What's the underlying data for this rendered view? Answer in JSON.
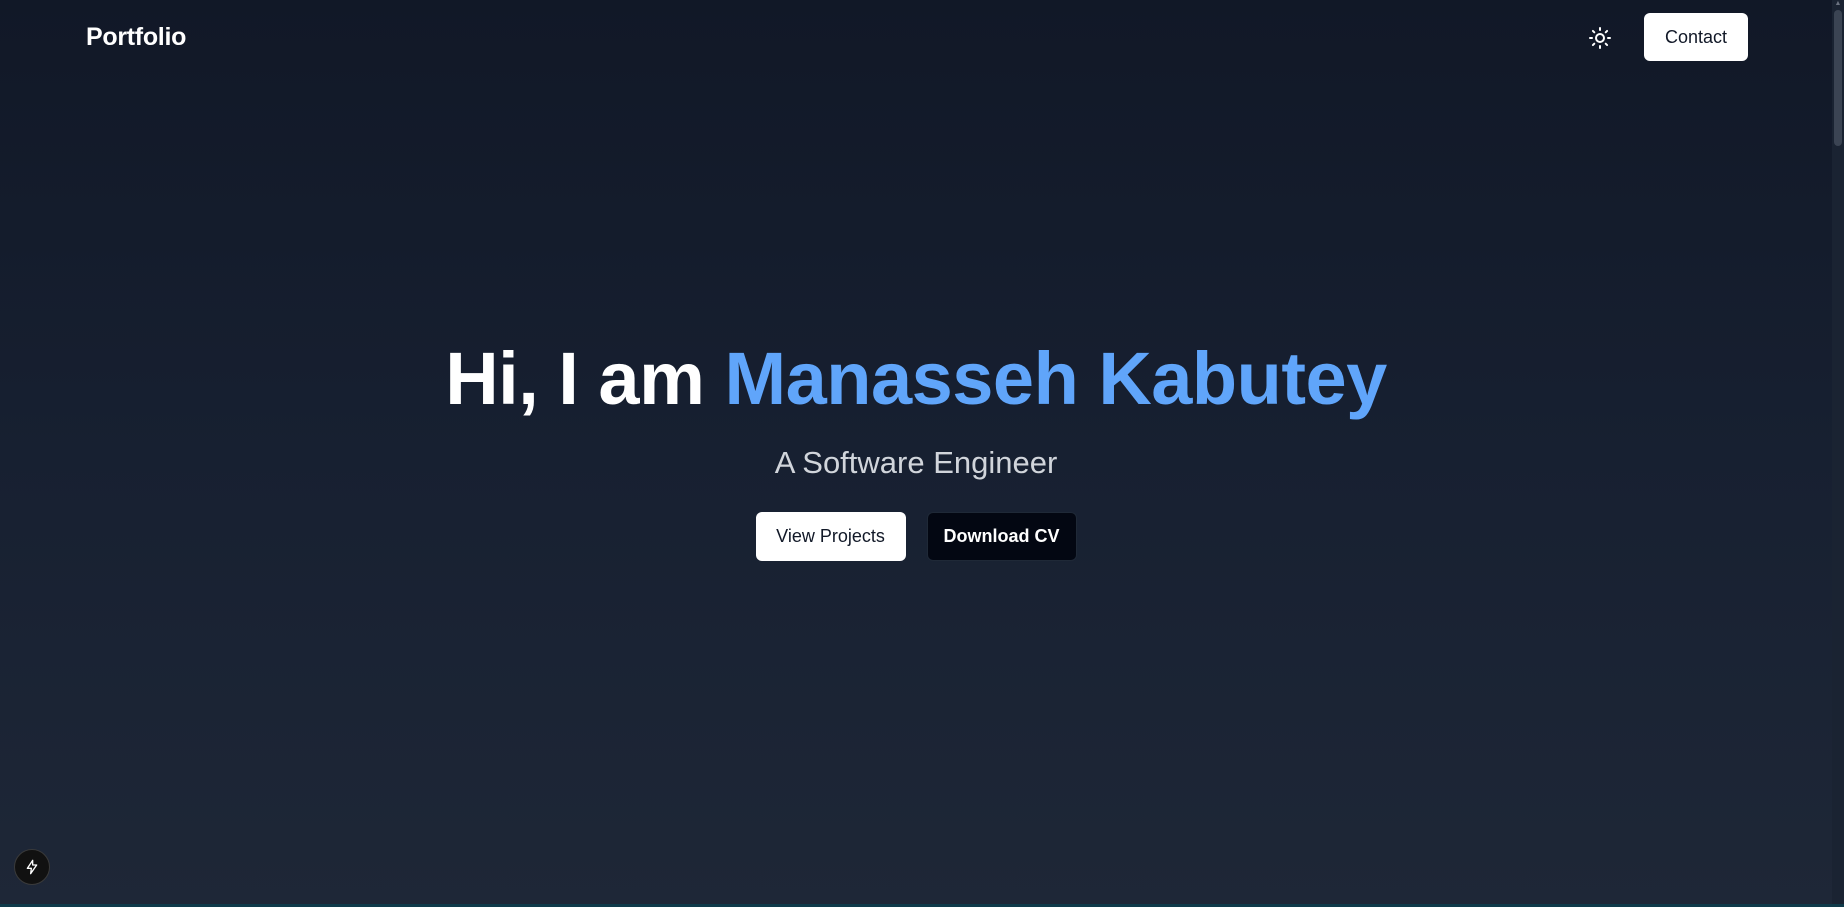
{
  "header": {
    "brand": "Portfolio",
    "theme_toggle_icon": "sun-icon",
    "contact_label": "Contact"
  },
  "hero": {
    "greeting": "Hi, I am ",
    "name": "Manasseh Kabutey",
    "subtitle": "A Software Engineer",
    "primary_cta": "View Projects",
    "secondary_cta": "Download CV"
  },
  "dev_badge": {
    "icon": "lightning-icon"
  },
  "colors": {
    "accent": "#60a5fa",
    "background_top": "#111827",
    "background_bottom": "#1e2737",
    "subtitle": "#d1d5db",
    "button_light": "#ffffff",
    "button_dark": "#030712"
  }
}
